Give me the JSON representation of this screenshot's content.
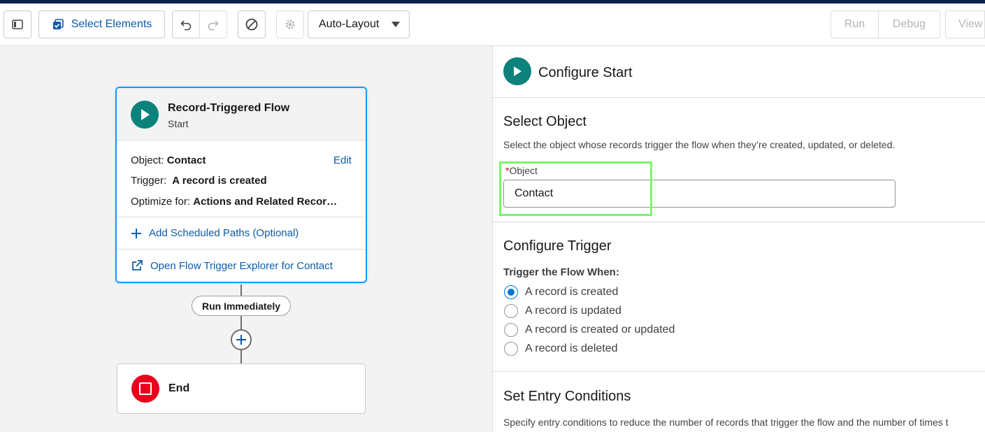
{
  "toolbar": {
    "select_elements_label": "Select Elements",
    "layout_value": "Auto-Layout",
    "run_label": "Run",
    "debug_label": "Debug",
    "view_label": "View"
  },
  "start_node": {
    "title": "Record-Triggered Flow",
    "subtitle": "Start",
    "object_label": "Object:",
    "object_value": "Contact",
    "edit_label": "Edit",
    "trigger_label": "Trigger:",
    "trigger_value": "A record is created",
    "optimize_label": "Optimize for:",
    "optimize_value": "Actions and Related Recor…",
    "add_paths_label": "Add Scheduled Paths (Optional)",
    "explorer_label": "Open Flow Trigger Explorer for Contact"
  },
  "path_label": "Run Immediately",
  "end_node": {
    "title": "End"
  },
  "panel": {
    "title": "Configure Start",
    "select_object": {
      "heading": "Select Object",
      "help": "Select the object whose records trigger the flow when they’re created, updated, or deleted.",
      "required_mark": "*",
      "field_label": "Object",
      "field_value": "Contact"
    },
    "configure_trigger": {
      "heading": "Configure Trigger",
      "group_label": "Trigger the Flow When:",
      "options": [
        {
          "label": "A record is created",
          "checked": true
        },
        {
          "label": "A record is updated",
          "checked": false
        },
        {
          "label": "A record is created or updated",
          "checked": false
        },
        {
          "label": "A record is deleted",
          "checked": false
        }
      ]
    },
    "entry_conditions": {
      "heading": "Set Entry Conditions",
      "help": "Specify entry conditions to reduce the number of records that trigger the flow and the number of times t"
    }
  },
  "colors": {
    "accent_blue": "#0b5cab",
    "teal": "#0b827c",
    "end_red": "#ea001e",
    "highlight_green": "#7bf56b",
    "selected_border": "#1b96ff"
  }
}
